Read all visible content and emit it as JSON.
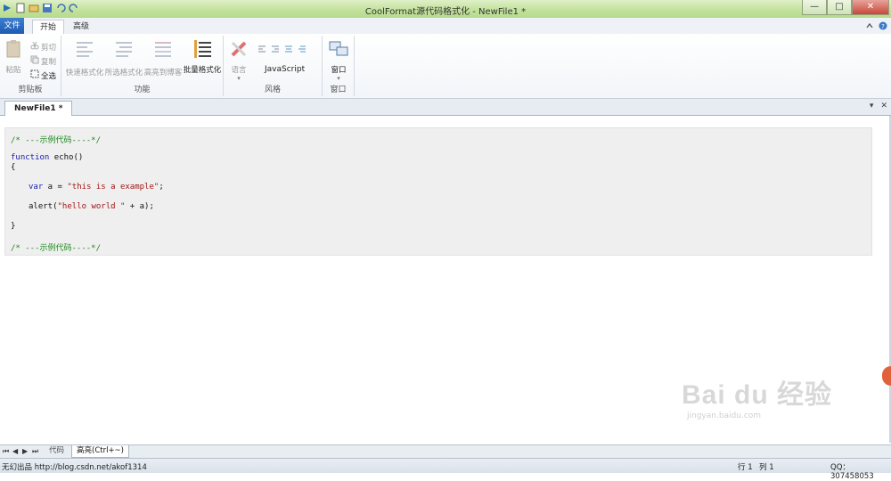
{
  "window": {
    "title": "CoolFormat源代码格式化 - NewFile1 *",
    "controls": [
      "—",
      "□",
      "✕"
    ]
  },
  "ribbon_tabs": [
    {
      "label": "文件"
    },
    {
      "label": "开始"
    },
    {
      "label": "高级"
    }
  ],
  "ribbon": {
    "clipboard": {
      "paste": "粘贴",
      "cut": "剪切",
      "copy": "复制",
      "select_all": "全选",
      "group_label": "剪贴板"
    },
    "functions": {
      "quick_format": "快速格式化",
      "selected_format": "所选格式化",
      "highlight_html": "高亮到博客",
      "batch_format": "批量格式化",
      "group_label": "功能"
    },
    "style": {
      "language": "语言",
      "current_language": "JavaScript",
      "group_label": "风格"
    },
    "window": {
      "window_btn": "窗口",
      "group_label": "窗口"
    }
  },
  "document_tab": "NewFile1 *",
  "code": {
    "line1": "/* ---示例代码----*/",
    "line2_kw": "function",
    "line2_rest": " echo()",
    "line3": "{",
    "line4_kw": "var",
    "line4_mid": " a = ",
    "line4_str": "\"this is a example\"",
    "line4_end": ";",
    "line5_pre": "alert(",
    "line5_str": "\"hello world \"",
    "line5_end": " + a);",
    "line6": "}",
    "line7": "/* ---示例代码----*/"
  },
  "watermark": {
    "brand": "Bai du 经验",
    "url": "jingyan.baidu.com"
  },
  "sheet_tabs": [
    {
      "label": "代码"
    },
    {
      "label": "高亮(Ctrl+~)"
    }
  ],
  "status": {
    "left": "无幻出品 http://blog.csdn.net/akof1314",
    "row": "行 1",
    "col": "列 1",
    "qq": "QQ：307458053"
  }
}
